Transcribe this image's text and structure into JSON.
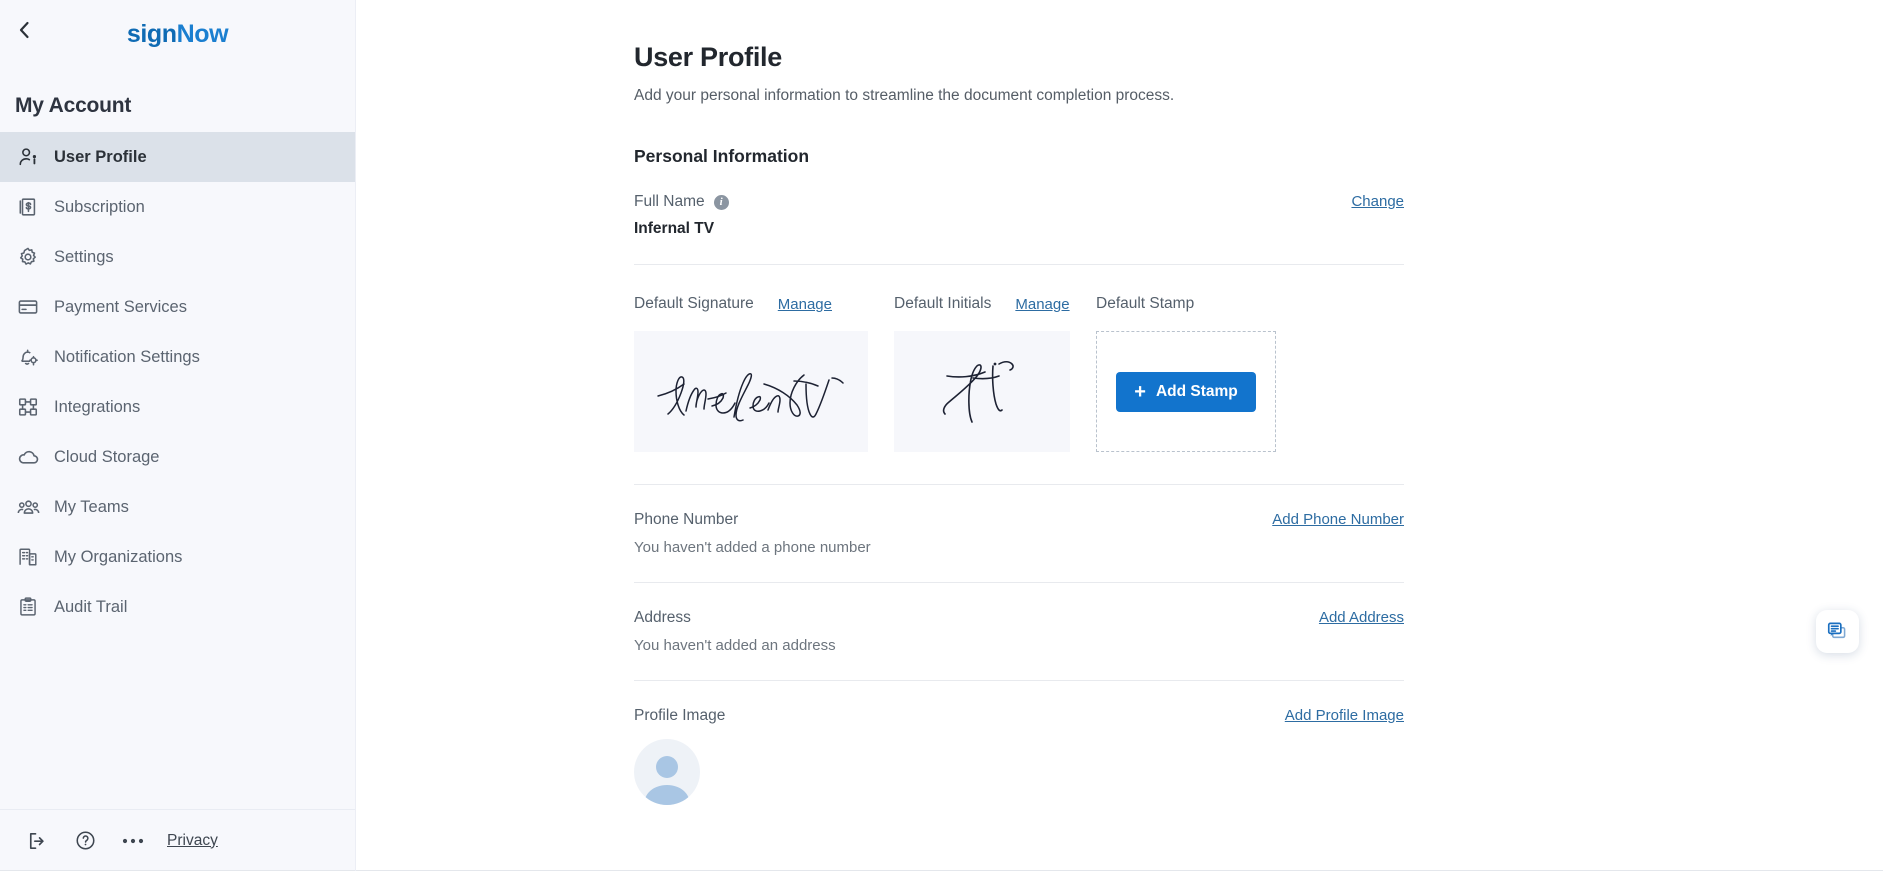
{
  "brand": {
    "name_part1": "sign",
    "name_part2": "Now",
    "color": "#1b7fd0"
  },
  "sidebar": {
    "back_icon": "chevron-left-icon",
    "account_title": "My Account",
    "items": [
      {
        "label": "User Profile",
        "icon": "user-profile-icon",
        "active": true
      },
      {
        "label": "Subscription",
        "icon": "subscription-icon",
        "active": false
      },
      {
        "label": "Settings",
        "icon": "gear-icon",
        "active": false
      },
      {
        "label": "Payment Services",
        "icon": "credit-card-icon",
        "active": false
      },
      {
        "label": "Notification Settings",
        "icon": "bell-settings-icon",
        "active": false
      },
      {
        "label": "Integrations",
        "icon": "integrations-icon",
        "active": false
      },
      {
        "label": "Cloud Storage",
        "icon": "cloud-icon",
        "active": false
      },
      {
        "label": "My Teams",
        "icon": "people-group-icon",
        "active": false
      },
      {
        "label": "My Organizations",
        "icon": "building-icon",
        "active": false
      },
      {
        "label": "Audit Trail",
        "icon": "clipboard-list-icon",
        "active": false
      }
    ],
    "footer": {
      "logout_icon": "logout-icon",
      "help_icon": "question-circle-icon",
      "more_icon": "ellipsis-icon",
      "privacy_label": "Privacy"
    }
  },
  "main": {
    "title": "User Profile",
    "subtitle": "Add your personal information to streamline the document completion process.",
    "section_heading": "Personal Information",
    "full_name": {
      "label": "Full Name",
      "info_icon": "info-icon",
      "value": "Infernal TV",
      "action_label": "Change"
    },
    "signature": {
      "signature_label": "Default Signature",
      "signature_manage_label": "Manage",
      "signature_value": "Infernal TV",
      "initials_label": "Default Initials",
      "initials_manage_label": "Manage",
      "initials_value": "IT",
      "stamp_label": "Default Stamp",
      "add_stamp_label": "Add Stamp",
      "add_stamp_plus": "+"
    },
    "phone": {
      "label": "Phone Number",
      "empty_text": "You haven't added a phone number",
      "action_label": "Add Phone Number"
    },
    "address": {
      "label": "Address",
      "empty_text": "You haven't added an address",
      "action_label": "Add Address"
    },
    "profile_image": {
      "label": "Profile Image",
      "action_label": "Add Profile Image",
      "avatar_icon": "avatar-placeholder-icon"
    }
  },
  "chat": {
    "icon": "chat-bubbles-icon",
    "accent": "#1b7fd0"
  }
}
